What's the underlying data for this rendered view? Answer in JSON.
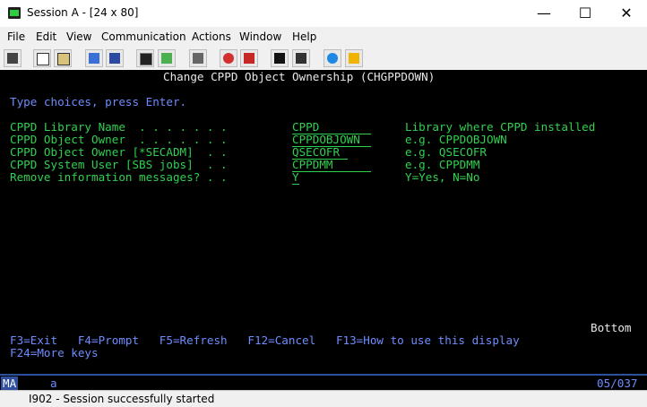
{
  "window": {
    "title": "Session A - [24 x 80]"
  },
  "window_controls": {
    "minimize": "—",
    "maximize": "☐",
    "close": "✕"
  },
  "menu": [
    "File",
    "Edit",
    "View",
    "Communication",
    "Actions",
    "Window",
    "Help"
  ],
  "toolbar_icons": [
    "print-screen-icon",
    "copy-icon",
    "paste-icon",
    "send-icon",
    "receive-icon",
    "display-icon",
    "color-icon",
    "keyboard-icon",
    "record-macro-icon",
    "play-macro-icon",
    "stop-macro-icon",
    "macro-menu-icon",
    "connect-icon",
    "disconnect-icon"
  ],
  "terminal": {
    "screen_title": "Change CPPD Object Ownership (CHGPPDOWN)",
    "instruction": "Type choices, press Enter.",
    "params": [
      {
        "label": "CPPD Library Name  . . . . . . .",
        "value": "CPPD",
        "help": "Library where CPPD installed"
      },
      {
        "label": "CPPD Object Owner  . . . . . . .",
        "value": "CPPDOBJOWN",
        "help": "e.g. CPPDOBJOWN"
      },
      {
        "label": "CPPD Object Owner [*SECADM]  . .",
        "value": "QSECOFR",
        "help": "e.g. QSECOFR"
      },
      {
        "label": "CPPD System User [SBS jobs]  . .",
        "value": "CPPDMM",
        "help": "e.g. CPPDMM"
      },
      {
        "label": "Remove information messages? . .",
        "value": "Y",
        "help": "Y=Yes, N=No"
      }
    ],
    "more_indicator": "Bottom",
    "function_keys_line1": "F3=Exit   F4=Prompt   F5=Refresh   F12=Cancel   F13=How to use this display",
    "function_keys_line2": "F24=More keys"
  },
  "oia": {
    "mode": "MA",
    "indicator": "a",
    "cursor_pos": "05/037"
  },
  "status": {
    "message": "I902 - Session successfully started"
  }
}
